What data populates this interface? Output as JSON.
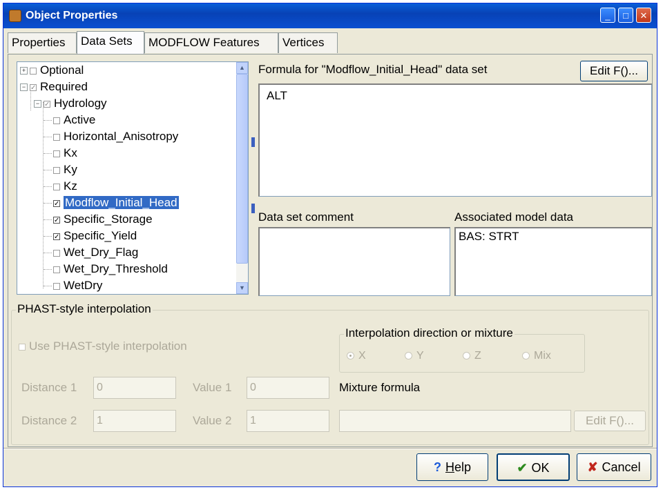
{
  "window": {
    "title": "Object Properties",
    "min_symbol": "_",
    "max_symbol": "□",
    "close_symbol": "✕"
  },
  "tabs": [
    {
      "label": "Properties",
      "active": false
    },
    {
      "label": "Data Sets",
      "active": true
    },
    {
      "label": "MODFLOW Features",
      "active": false
    },
    {
      "label": "Vertices",
      "active": false
    }
  ],
  "tree": {
    "optional": {
      "label": "Optional",
      "expander": "+",
      "checked": false
    },
    "required": {
      "label": "Required",
      "expander": "−",
      "checked": true
    },
    "hydrology": {
      "label": "Hydrology",
      "expander": "−",
      "checked": true
    },
    "items": [
      {
        "label": "Active",
        "checked": false,
        "selected": false
      },
      {
        "label": "Horizontal_Anisotropy",
        "checked": false,
        "selected": false
      },
      {
        "label": "Kx",
        "checked": false,
        "selected": false
      },
      {
        "label": "Ky",
        "checked": false,
        "selected": false
      },
      {
        "label": "Kz",
        "checked": false,
        "selected": false
      },
      {
        "label": "Modflow_Initial_Head",
        "checked": true,
        "selected": true
      },
      {
        "label": "Specific_Storage",
        "checked": true,
        "selected": false
      },
      {
        "label": "Specific_Yield",
        "checked": true,
        "selected": false
      },
      {
        "label": "Wet_Dry_Flag",
        "checked": false,
        "selected": false
      },
      {
        "label": "Wet_Dry_Threshold",
        "checked": false,
        "selected": false
      },
      {
        "label": "WetDry",
        "checked": false,
        "selected": false
      }
    ],
    "check_mark": "✓"
  },
  "formula": {
    "label": "Formula for \"Modflow_Initial_Head\" data set",
    "edit_button": "Edit F()...",
    "value": "ALT"
  },
  "comment": {
    "label": "Data set comment",
    "value": ""
  },
  "associated": {
    "label": "Associated model data",
    "value": "BAS: STRT"
  },
  "phast": {
    "group_title": "PHAST-style interpolation",
    "use_checkbox_label": "Use PHAST-style interpolation",
    "use_checked": false,
    "direction_group_title": "Interpolation direction or mixture",
    "radios": [
      {
        "label": "X",
        "checked": true
      },
      {
        "label": "Y",
        "checked": false
      },
      {
        "label": "Z",
        "checked": false
      },
      {
        "label": "Mix",
        "checked": false
      }
    ],
    "distance1_label": "Distance 1",
    "distance1_value": "0",
    "value1_label": "Value 1",
    "value1_value": "0",
    "distance2_label": "Distance 2",
    "distance2_value": "1",
    "value2_label": "Value 2",
    "value2_value": "1",
    "mixture_label": "Mixture formula",
    "mixture_value": "",
    "mixture_edit_button": "Edit F()..."
  },
  "footer": {
    "help_icon": "?",
    "help_label": "Help",
    "help_label_underline": "H",
    "help_label_rest": "elp",
    "ok_icon": "✔",
    "ok_label": "OK",
    "cancel_icon": "✘",
    "cancel_label": "Cancel"
  },
  "scroll": {
    "up": "▲",
    "down": "▼"
  }
}
